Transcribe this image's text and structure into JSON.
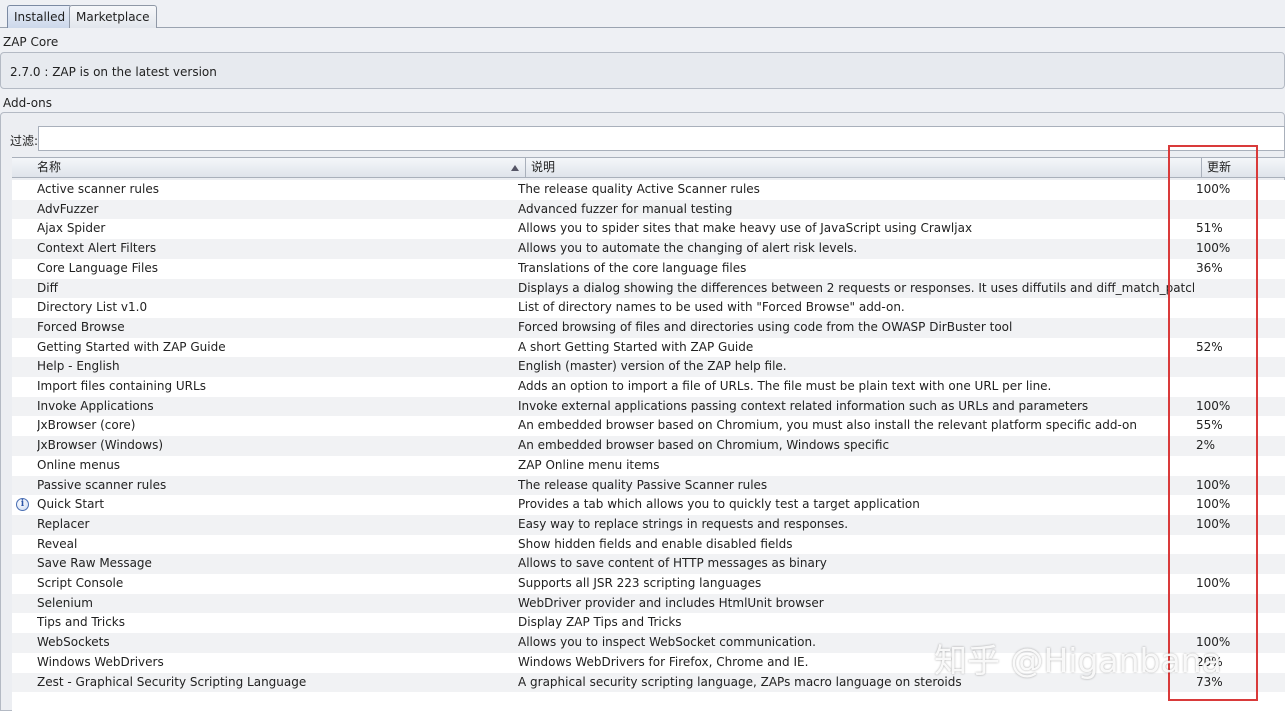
{
  "tabs": [
    {
      "label": "Installed",
      "active": true
    },
    {
      "label": "Marketplace",
      "active": false
    }
  ],
  "core": {
    "section_label": "ZAP Core",
    "status": "2.7.0 : ZAP is on the latest version"
  },
  "addons": {
    "section_label": "Add-ons",
    "filter_label": "过滤:",
    "filter_value": "",
    "columns": {
      "name": "名称",
      "description": "说明",
      "update": "更新"
    },
    "rows": [
      {
        "name": "Active scanner rules",
        "description": "The release quality Active Scanner rules",
        "update": "100%",
        "icon": ""
      },
      {
        "name": "AdvFuzzer",
        "description": "Advanced fuzzer for manual testing",
        "update": "",
        "icon": ""
      },
      {
        "name": "Ajax Spider",
        "description": "Allows you to spider sites that make heavy use of JavaScript using Crawljax",
        "update": "51%",
        "icon": ""
      },
      {
        "name": "Context Alert Filters",
        "description": "Allows you to automate the changing of alert risk levels.",
        "update": "100%",
        "icon": ""
      },
      {
        "name": "Core Language Files",
        "description": "Translations of the core language files",
        "update": "36%",
        "icon": ""
      },
      {
        "name": "Diff",
        "description": "Displays a dialog showing the differences between 2 requests or responses. It uses diffutils and diff_match_patch",
        "update": "",
        "icon": ""
      },
      {
        "name": "Directory List v1.0",
        "description": "List of directory names to be used with \"Forced Browse\" add-on.",
        "update": "",
        "icon": ""
      },
      {
        "name": "Forced Browse",
        "description": "Forced browsing of files and directories using code from the OWASP DirBuster tool",
        "update": "",
        "icon": ""
      },
      {
        "name": "Getting Started with ZAP Guide",
        "description": "A short Getting Started with ZAP Guide",
        "update": "52%",
        "icon": ""
      },
      {
        "name": "Help - English",
        "description": "English (master) version of the ZAP help file.",
        "update": "",
        "icon": ""
      },
      {
        "name": "Import files containing URLs",
        "description": "Adds an option to import a file of URLs. The file must be plain text with one URL per line.",
        "update": "",
        "icon": ""
      },
      {
        "name": "Invoke Applications",
        "description": "Invoke external applications passing context related information such as URLs and parameters",
        "update": "100%",
        "icon": ""
      },
      {
        "name": "JxBrowser (core)",
        "description": "An embedded browser based on Chromium, you must also install the relevant platform specific add-on",
        "update": "55%",
        "icon": ""
      },
      {
        "name": "JxBrowser (Windows)",
        "description": "An embedded browser based on Chromium, Windows specific",
        "update": "2%",
        "icon": ""
      },
      {
        "name": "Online menus",
        "description": "ZAP Online menu items",
        "update": "",
        "icon": ""
      },
      {
        "name": "Passive scanner rules",
        "description": "The release quality Passive Scanner rules",
        "update": "100%",
        "icon": ""
      },
      {
        "name": "Quick Start",
        "description": "Provides a tab which allows you to quickly test a target application",
        "update": "100%",
        "icon": "info-icon"
      },
      {
        "name": "Replacer",
        "description": "Easy way to replace strings in requests and responses.",
        "update": "100%",
        "icon": ""
      },
      {
        "name": "Reveal",
        "description": "Show hidden fields and enable disabled fields",
        "update": "",
        "icon": ""
      },
      {
        "name": "Save Raw Message",
        "description": "Allows to save content of HTTP messages as binary",
        "update": "",
        "icon": ""
      },
      {
        "name": "Script Console",
        "description": "Supports all JSR 223 scripting languages",
        "update": "100%",
        "icon": ""
      },
      {
        "name": "Selenium",
        "description": "WebDriver provider and includes HtmlUnit browser",
        "update": "",
        "icon": ""
      },
      {
        "name": "Tips and Tricks",
        "description": "Display ZAP Tips and Tricks",
        "update": "",
        "icon": ""
      },
      {
        "name": "WebSockets",
        "description": "Allows you to inspect WebSocket communication.",
        "update": "100%",
        "icon": ""
      },
      {
        "name": "Windows WebDrivers",
        "description": "Windows WebDrivers for Firefox, Chrome and IE.",
        "update": "20%",
        "icon": ""
      },
      {
        "name": "Zest - Graphical Security Scripting Language",
        "description": "A graphical security scripting language, ZAPs macro language on steroids",
        "update": "73%",
        "icon": ""
      }
    ]
  },
  "annotation": {
    "color": "#d93a3a"
  },
  "watermark": "知乎 @Higanbana"
}
